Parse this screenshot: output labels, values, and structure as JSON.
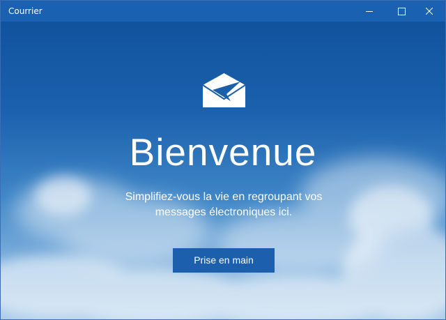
{
  "window": {
    "title": "Courrier"
  },
  "titlebar_controls": {
    "minimize": "minimize",
    "maximize": "maximize",
    "close": "close"
  },
  "welcome": {
    "heading": "Bienvenue",
    "subtitle": "Simplifiez-vous la vie en regroupant vos messages électroniques ici.",
    "cta_label": "Prise en main"
  },
  "icons": {
    "app_icon": "mail-envelope-icon"
  },
  "colors": {
    "titlebar": "#1a62b1",
    "button": "#1c5fad",
    "text": "#ffffff"
  }
}
